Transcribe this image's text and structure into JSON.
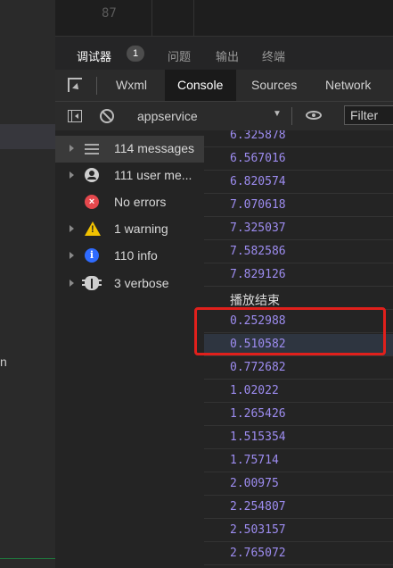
{
  "editor": {
    "line_number": "87"
  },
  "left_strip": {
    "partial_text": "n"
  },
  "panel_tabs": {
    "items": [
      {
        "label": "调试器",
        "active": true
      },
      {
        "label": "问题",
        "active": false
      },
      {
        "label": "输出",
        "active": false
      },
      {
        "label": "终端",
        "active": false
      }
    ],
    "badge": "1"
  },
  "devtools_tabs": [
    "Wxml",
    "Console",
    "Sources",
    "Network"
  ],
  "toolbar": {
    "context": "appservice",
    "filter_placeholder": "Filter"
  },
  "sidebar": {
    "items": [
      {
        "icon": "list-icon",
        "label": "114 messages"
      },
      {
        "icon": "user-icon",
        "label": "111 user me..."
      },
      {
        "icon": "error-icon",
        "label": "No errors"
      },
      {
        "icon": "warning-icon",
        "label": "1 warning"
      },
      {
        "icon": "info-icon",
        "label": "110 info"
      },
      {
        "icon": "bug-icon",
        "label": "3 verbose"
      }
    ]
  },
  "console": {
    "lines": [
      "6.325878",
      "6.567016",
      "6.820574",
      "7.070618",
      "7.325037",
      "7.582586",
      "7.829126",
      "播放结束",
      "0.252988",
      "0.510582",
      "0.772682",
      "1.02022",
      "1.265426",
      "1.515354",
      "1.75714",
      "2.00975",
      "2.254807",
      "2.503157",
      "2.765072"
    ]
  },
  "colors": {
    "highlight": "#e0201c",
    "log_value": "#9d8cf0"
  }
}
